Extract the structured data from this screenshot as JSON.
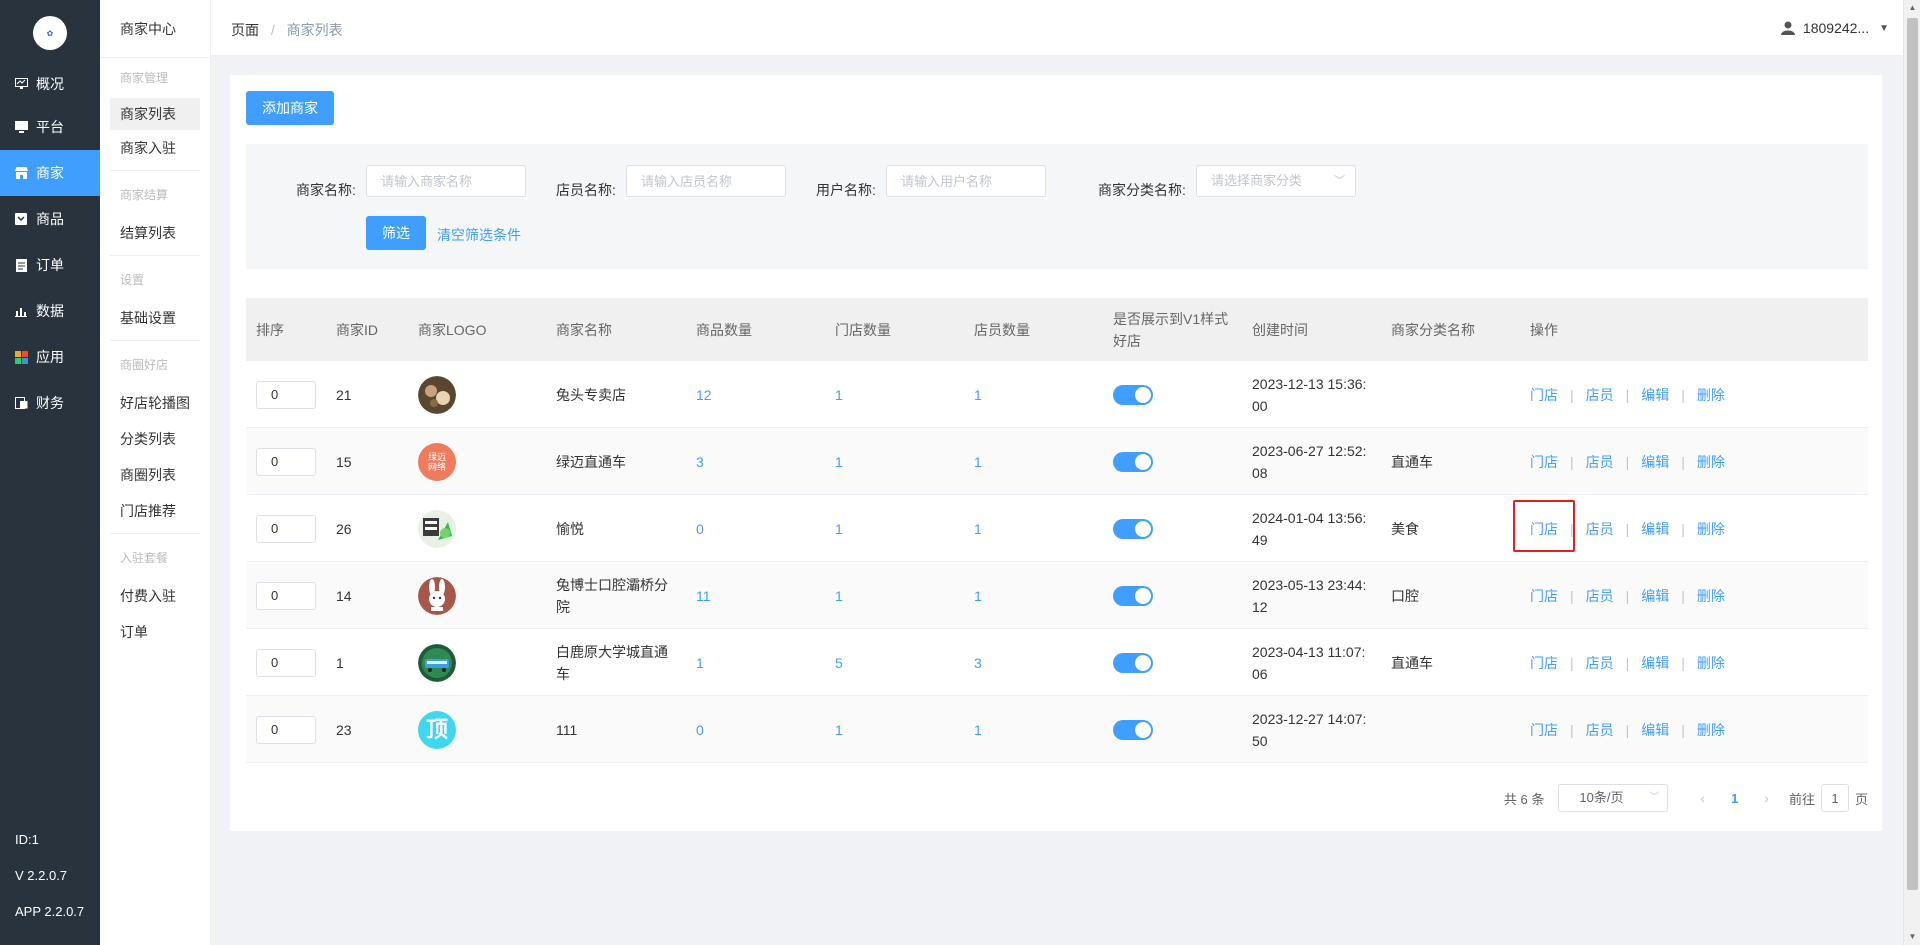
{
  "nav": {
    "items": [
      {
        "label": "概况",
        "icon": "monitor-chart-icon"
      },
      {
        "label": "平台",
        "icon": "desktop-icon"
      },
      {
        "label": "商家",
        "icon": "store-icon",
        "active": true
      },
      {
        "label": "商品",
        "icon": "goods-icon"
      },
      {
        "label": "订单",
        "icon": "order-icon"
      },
      {
        "label": "数据",
        "icon": "bar-chart-icon"
      },
      {
        "label": "应用",
        "icon": "apps-icon"
      },
      {
        "label": "财务",
        "icon": "finance-icon"
      }
    ],
    "footer": {
      "id": "ID:1",
      "version": "V 2.2.0.7",
      "app_version": "APP 2.2.0.7"
    }
  },
  "subnav": {
    "title": "商家中心",
    "groups": [
      {
        "heading": "商家管理",
        "items": [
          "商家列表",
          "商家入驻"
        ]
      },
      {
        "heading": "商家结算",
        "items": [
          "结算列表"
        ]
      },
      {
        "heading": "设置",
        "items": [
          "基础设置"
        ]
      },
      {
        "heading": "商圈好店",
        "items": [
          "好店轮播图",
          "分类列表",
          "商圈列表",
          "门店推荐"
        ]
      },
      {
        "heading": "入驻套餐",
        "items": [
          "付费入驻",
          "订单"
        ]
      }
    ]
  },
  "breadcrumb": {
    "root": "页面",
    "separator": "/",
    "current": "商家列表"
  },
  "user": {
    "name": "1809242..."
  },
  "toolbar": {
    "add_label": "添加商家"
  },
  "filter": {
    "merchant_name": {
      "label": "商家名称:",
      "placeholder": "请输入商家名称"
    },
    "clerk_name": {
      "label": "店员名称:",
      "placeholder": "请输入店员名称"
    },
    "user_name": {
      "label": "用户名称:",
      "placeholder": "请输入用户名称"
    },
    "category": {
      "label": "商家分类名称:",
      "placeholder": "请选择商家分类"
    },
    "filter_label": "筛选",
    "clear_label": "清空筛选条件"
  },
  "table": {
    "headers": {
      "sort": "排序",
      "id": "商家ID",
      "logo": "商家LOGO",
      "name": "商家名称",
      "goods": "商品数量",
      "stores": "门店数量",
      "clerks": "店员数量",
      "show_v1_line1": "是否展示到V1样式",
      "show_v1_line2": "好店",
      "created": "创建时间",
      "category": "商家分类名称",
      "ops": "操作"
    },
    "op_labels": {
      "store": "门店",
      "clerk": "店员",
      "edit": "编辑",
      "delete": "删除"
    },
    "rows": [
      {
        "sort": "0",
        "id": "21",
        "name": "兔头专卖店",
        "goods": "12",
        "stores": "1",
        "clerks": "1",
        "show_v1": true,
        "created_line1": "2023-12-13 15:36:",
        "created_line2": "00",
        "category": "",
        "logo_text": ""
      },
      {
        "sort": "0",
        "id": "15",
        "name": "绿迈直通车",
        "goods": "3",
        "stores": "1",
        "clerks": "1",
        "show_v1": true,
        "created_line1": "2023-06-27 12:52:",
        "created_line2": "08",
        "category": "直通车",
        "logo_text": "绿迈网络"
      },
      {
        "sort": "0",
        "id": "26",
        "name": "愉悦",
        "goods": "0",
        "stores": "1",
        "clerks": "1",
        "show_v1": true,
        "created_line1": "2024-01-04 13:56:",
        "created_line2": "49",
        "category": "美食",
        "logo_text": ""
      },
      {
        "sort": "0",
        "id": "14",
        "name_line1": "兔博士口腔灞桥分",
        "name_line2": "院",
        "goods": "11",
        "stores": "1",
        "clerks": "1",
        "show_v1": true,
        "created_line1": "2023-05-13 23:44:",
        "created_line2": "12",
        "category": "口腔",
        "logo_text": ""
      },
      {
        "sort": "0",
        "id": "1",
        "name_line1": "白鹿原大学城直通",
        "name_line2": "车",
        "goods": "1",
        "stores": "5",
        "clerks": "3",
        "show_v1": true,
        "created_line1": "2023-04-13 11:07:",
        "created_line2": "06",
        "category": "直通车",
        "logo_text": ""
      },
      {
        "sort": "0",
        "id": "23",
        "name": "111",
        "goods": "0",
        "stores": "1",
        "clerks": "1",
        "show_v1": true,
        "created_line1": "2023-12-27 14:07:",
        "created_line2": "50",
        "category": "",
        "logo_text": "顶"
      }
    ]
  },
  "pagination": {
    "total": "共 6 条",
    "page_size": "10条/页",
    "current": "1",
    "goto_prefix": "前往",
    "goto_value": "1",
    "goto_suffix": "页"
  },
  "colors": {
    "primary": "#409eff",
    "sidebar": "#28333e",
    "highlight": "#e02020"
  }
}
